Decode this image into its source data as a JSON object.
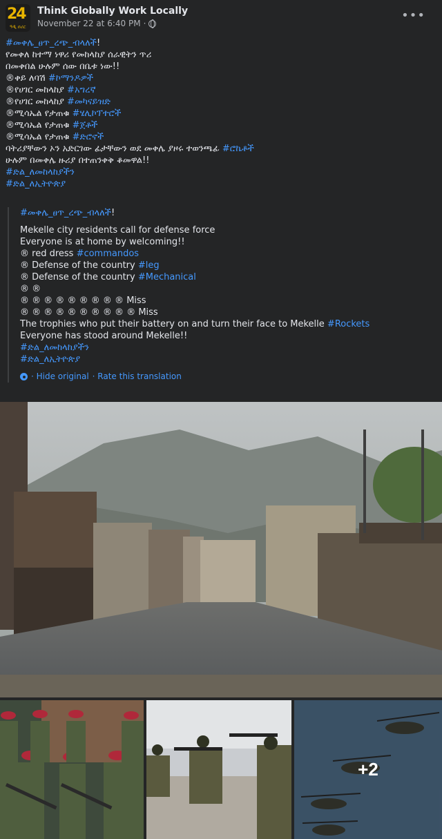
{
  "header": {
    "page_name": "Think Globally Work Locally",
    "date": "November 22 at 6:40 PM",
    "dot": "·",
    "avatar_text": "24",
    "avatar_sub": "ዓዲ ዐሪር"
  },
  "post": {
    "lines": [
      [
        {
          "t": "#መቀሌ_ፀጥ_ረጭ_ብላለች",
          "tag": true
        },
        {
          "t": "!"
        }
      ],
      [
        {
          "t": "የመቀለ ከተማ ነዋሪ የመከላከያ ሰራዊትን ጥሪ"
        }
      ],
      [
        {
          "t": "በመቀበል ሁሉም ሰው በቤቱ ነው!!"
        }
      ],
      [
        {
          "t": "®ቀይ ለባሽ "
        },
        {
          "t": "#ኮማንዶዎች",
          "tag": true
        }
      ],
      [
        {
          "t": "®የሀገር መከላከያ "
        },
        {
          "t": "#አግረኛ",
          "tag": true
        }
      ],
      [
        {
          "t": "®የሀገር መከላከያ "
        },
        {
          "t": "#መካናይዝድ",
          "tag": true
        }
      ],
      [
        {
          "t": "®ሚሳኤል የታጠቁ "
        },
        {
          "t": "#ሄሊኮፕተሮች",
          "tag": true
        }
      ],
      [
        {
          "t": "®ሚሳኤል የታጠቁ "
        },
        {
          "t": "#ጀቶች",
          "tag": true
        }
      ],
      [
        {
          "t": "®ሚሳኤል የታጠቁ "
        },
        {
          "t": "#ድሮኖች",
          "tag": true
        }
      ],
      [
        {
          "t": "ባትሪያቸውን ኦን አድርገው ፊታቸውን ወደ መቀሌ ያዞሩ ተወንጫፊ "
        },
        {
          "t": "#ሮኬቶች",
          "tag": true
        }
      ],
      [
        {
          "t": "ሁሉም በመቀሌ ዙሪያ በተጠንቀቅ ቆመዋል!!"
        }
      ],
      [
        {
          "t": "#ድል_ለመከላከያችን",
          "tag": true
        }
      ],
      [
        {
          "t": "#ድል_ለኢትዮጵያ",
          "tag": true
        }
      ]
    ]
  },
  "translation": {
    "lines": [
      [
        {
          "t": "#መቀሌ_ፀጥ_ረጭ_ብላለች",
          "tag": true
        },
        {
          "t": "!"
        }
      ],
      [],
      [
        {
          "t": "Mekelle city residents call for defense force"
        }
      ],
      [
        {
          "t": "Everyone is at home by welcoming!!"
        }
      ],
      [
        {
          "t": "® red dress "
        },
        {
          "t": "#commandos",
          "tag": true
        }
      ],
      [
        {
          "t": "® Defense of the country "
        },
        {
          "t": "#leg",
          "tag": true
        }
      ],
      [
        {
          "t": "® Defense of the country "
        },
        {
          "t": "#Mechanical",
          "tag": true
        }
      ],
      [
        {
          "t": "® ®"
        }
      ],
      [
        {
          "t": "® ® ® ® ® ® ® ® ® Miss"
        }
      ],
      [
        {
          "t": "® ® ® ® ® ® ® ® ® ® Miss"
        }
      ],
      [
        {
          "t": "The trophies who put their battery on and turn their face to Mekelle "
        },
        {
          "t": "#Rockets",
          "tag": true
        }
      ],
      [
        {
          "t": "Everyone has stood around Mekelle!!"
        }
      ],
      [
        {
          "t": "#ድል_ለመከላከያችን",
          "tag": true
        }
      ],
      [
        {
          "t": "#ድል_ለኢትዮጵያ",
          "tag": true
        }
      ]
    ],
    "hide_original": "· Hide original",
    "rate": "· Rate this translation"
  },
  "media": {
    "more_count": "+2",
    "icons": {
      "more": "more-options-icon",
      "privacy": "globe-icon",
      "settings": "gear-icon"
    }
  },
  "colors": {
    "background": "#242526",
    "text": "#e4e6eb",
    "secondary": "#b0b3b8",
    "link": "#4599ff"
  }
}
